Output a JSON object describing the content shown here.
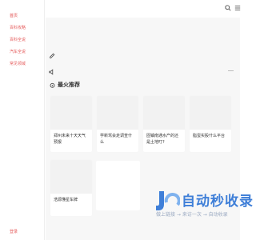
{
  "sidebar": {
    "items": [
      {
        "label": "首页"
      },
      {
        "label": "百科攻略"
      },
      {
        "label": "百科全说"
      },
      {
        "label": "汽车全说"
      },
      {
        "label": "常见领域"
      }
    ],
    "bottom_label": "登录"
  },
  "section": {
    "title": "最火推荐"
  },
  "cards": [
    {
      "title": "郑州未来十天天气预报"
    },
    {
      "title": "学新驾会走调查什么"
    },
    {
      "title": "固镇南通水产的还是土地叮?"
    },
    {
      "title": "脂蛋实股什么平台"
    },
    {
      "title": "浩源懂星车牌"
    }
  ],
  "watermark": {
    "main": "自动秒收录",
    "sub": "做上链接 → 来访一次 → 自动收录"
  },
  "colors": {
    "accent": "#e55c5c",
    "watermark": "#3f7fd8"
  },
  "icons": [
    "search-icon",
    "menu-icon",
    "pencil-icon",
    "speaker-icon",
    "fire-icon"
  ]
}
